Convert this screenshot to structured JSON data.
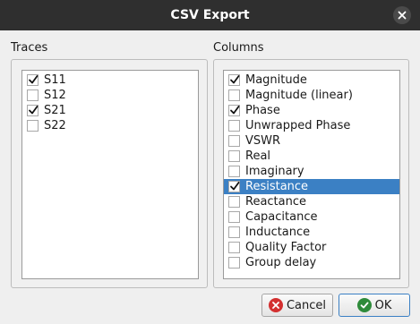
{
  "window": {
    "title": "CSV Export",
    "close_icon": "close-icon"
  },
  "traces": {
    "label": "Traces",
    "items": [
      {
        "label": "S11",
        "checked": true
      },
      {
        "label": "S12",
        "checked": false
      },
      {
        "label": "S21",
        "checked": true
      },
      {
        "label": "S22",
        "checked": false
      }
    ]
  },
  "columns": {
    "label": "Columns",
    "items": [
      {
        "label": "Magnitude",
        "checked": true,
        "selected": false
      },
      {
        "label": "Magnitude (linear)",
        "checked": false,
        "selected": false
      },
      {
        "label": "Phase",
        "checked": true,
        "selected": false
      },
      {
        "label": "Unwrapped Phase",
        "checked": false,
        "selected": false
      },
      {
        "label": "VSWR",
        "checked": false,
        "selected": false
      },
      {
        "label": "Real",
        "checked": false,
        "selected": false
      },
      {
        "label": "Imaginary",
        "checked": false,
        "selected": false
      },
      {
        "label": "Resistance",
        "checked": true,
        "selected": true
      },
      {
        "label": "Reactance",
        "checked": false,
        "selected": false
      },
      {
        "label": "Capacitance",
        "checked": false,
        "selected": false
      },
      {
        "label": "Inductance",
        "checked": false,
        "selected": false
      },
      {
        "label": "Quality Factor",
        "checked": false,
        "selected": false
      },
      {
        "label": "Group delay",
        "checked": false,
        "selected": false
      }
    ]
  },
  "buttons": {
    "cancel": {
      "label": "Cancel",
      "icon": "cancel-icon",
      "color": "#d32f2f"
    },
    "ok": {
      "label": "OK",
      "icon": "ok-check-icon",
      "color": "#2e8b3a"
    }
  },
  "colors": {
    "titlebar": "#2f2f2f",
    "selection": "#3b80c4"
  }
}
